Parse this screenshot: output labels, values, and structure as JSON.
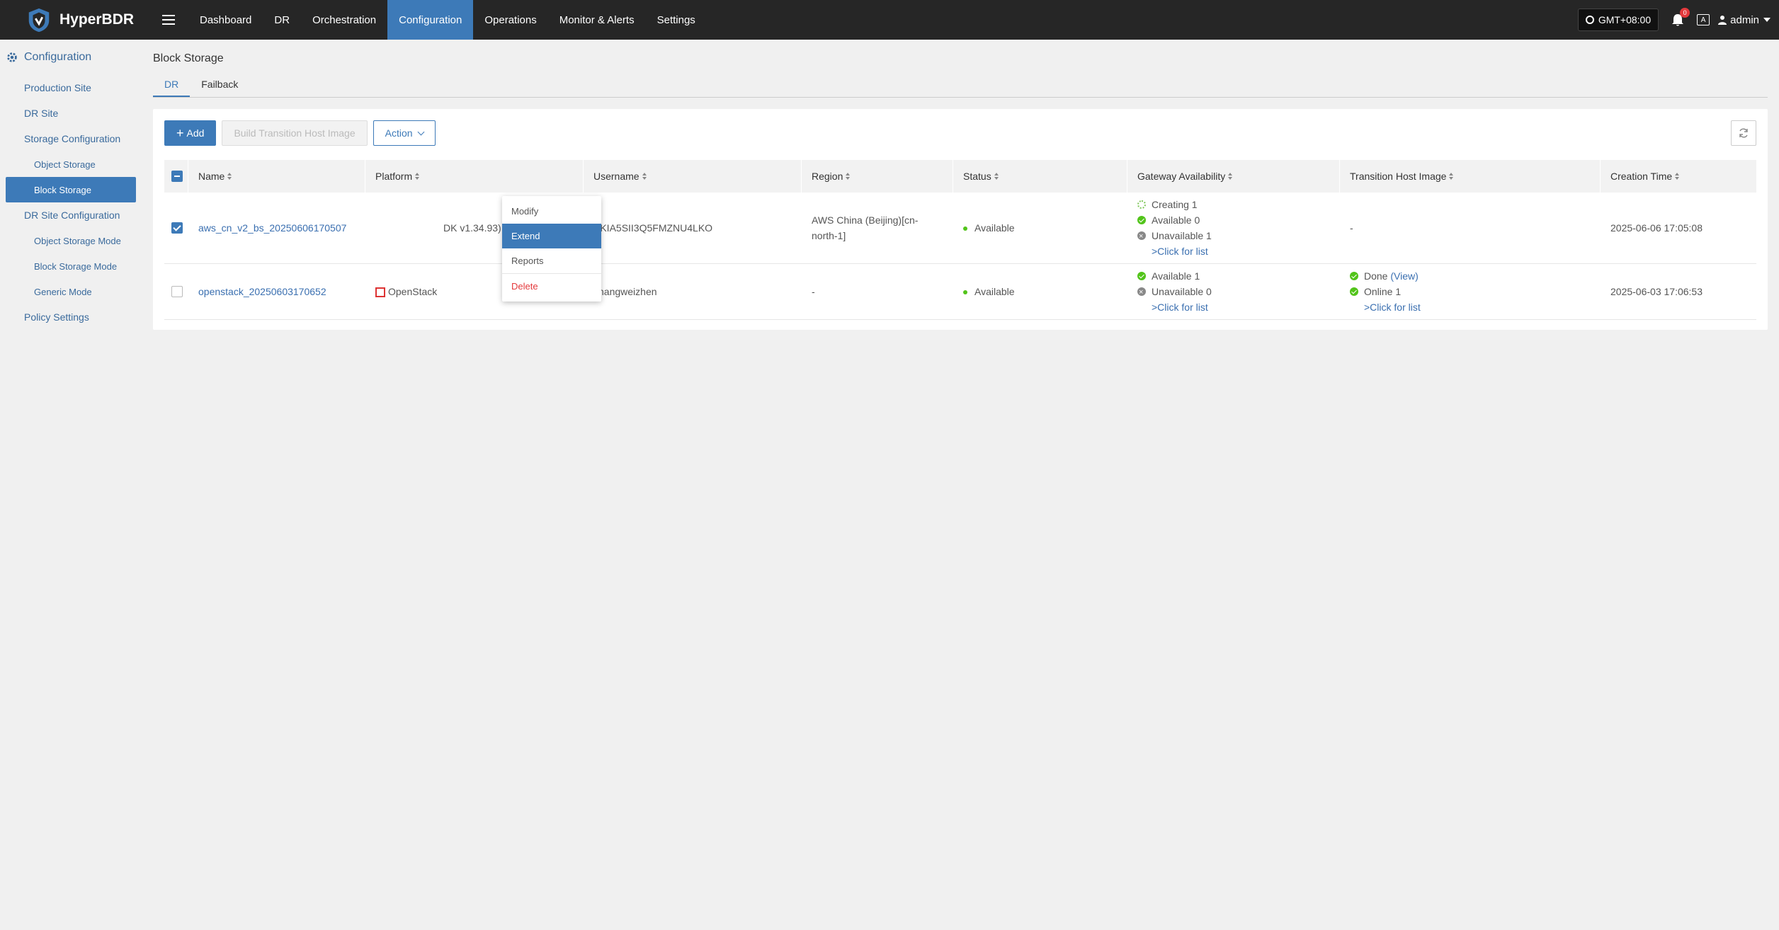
{
  "brand": {
    "name": "HyperBDR"
  },
  "nav": [
    {
      "label": "Dashboard",
      "active": false
    },
    {
      "label": "DR",
      "active": false
    },
    {
      "label": "Orchestration",
      "active": false
    },
    {
      "label": "Configuration",
      "active": true
    },
    {
      "label": "Operations",
      "active": false
    },
    {
      "label": "Monitor & Alerts",
      "active": false
    },
    {
      "label": "Settings",
      "active": false
    }
  ],
  "header_right": {
    "timezone": "GMT+08:00",
    "notification_count": "0",
    "lang": "A",
    "user": "admin"
  },
  "sidebar": {
    "title": "Configuration",
    "items": [
      {
        "label": "Production Site"
      },
      {
        "label": "DR Site"
      },
      {
        "label": "Storage Configuration"
      },
      {
        "label": "Object Storage"
      },
      {
        "label": "Block Storage"
      },
      {
        "label": "DR Site Configuration"
      },
      {
        "label": "Object Storage Mode"
      },
      {
        "label": "Block Storage Mode"
      },
      {
        "label": "Generic Mode"
      },
      {
        "label": "Policy Settings"
      }
    ]
  },
  "page": {
    "title": "Block Storage",
    "tabs": [
      "DR",
      "Failback"
    ]
  },
  "toolbar": {
    "add": "Add",
    "build": "Build Transition Host Image",
    "action": "Action"
  },
  "dropdown": [
    "Modify",
    "Extend",
    "Reports",
    "Delete"
  ],
  "table": {
    "columns": [
      "Name",
      "Platform",
      "Username",
      "Region",
      "Status",
      "Gateway Availability",
      "Transition Host Image",
      "Creation Time"
    ],
    "rows": [
      {
        "name": "aws_cn_v2_bs_20250606170507",
        "platform": "DK v1.34.93)",
        "username": "AKIA5SII3Q5FMZNU4LKO",
        "region": "AWS China (Beijing)[cn-north-1]",
        "status": "Available",
        "gateway": [
          "Creating 1",
          "Available 0",
          "Unavailable 1"
        ],
        "gateway_link": ">Click for list",
        "transition": "-",
        "created": "2025-06-06 17:05:08"
      },
      {
        "name": "openstack_20250603170652",
        "platform": "OpenStack",
        "username": "zhangweizhen",
        "region": "-",
        "status": "Available",
        "gateway": [
          "Available 1",
          "Unavailable 0"
        ],
        "gateway_link": ">Click for list",
        "transition_done": "Done",
        "transition_view": "(View)",
        "transition_online": "Online 1",
        "transition_link": ">Click for list",
        "created": "2025-06-03 17:06:53"
      }
    ]
  },
  "colors": {
    "accent": "#3d7ab8",
    "topbar": "#262626",
    "success": "#52c41a",
    "danger": "#e4393c"
  }
}
